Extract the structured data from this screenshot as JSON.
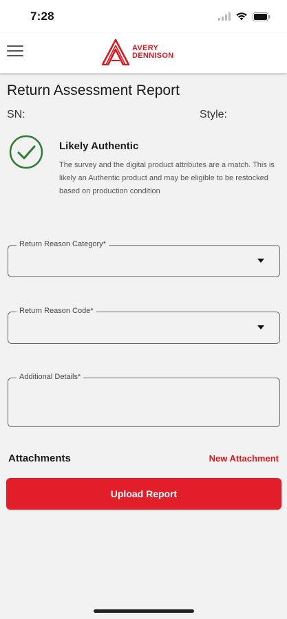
{
  "status_bar": {
    "time": "7:28"
  },
  "header": {
    "brand_line1": "AVERY",
    "brand_line2": "DENNISON"
  },
  "report": {
    "title": "Return Assessment Report",
    "sn_label": "SN:",
    "style_label": "Style:",
    "result_title": "Likely Authentic",
    "result_description": "The survey and the digital product attributes are a match. This is likely an Authentic product and may be eligible to be restocked based on production condition"
  },
  "form": {
    "reason_category_label": "Return Reason Category*",
    "reason_category_value": "",
    "reason_code_label": "Return Reason Code*",
    "reason_code_value": "",
    "details_label": "Additional Details*",
    "details_value": ""
  },
  "attachments": {
    "label": "Attachments",
    "new_label": "New Attachment"
  },
  "actions": {
    "upload_label": "Upload Report"
  },
  "colors": {
    "brand_red": "#e21e2a",
    "check_green": "#2e7d32"
  }
}
